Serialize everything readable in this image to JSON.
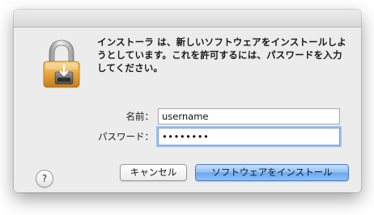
{
  "dialog": {
    "message": "インストーラ は、新しいソフトウェアをインストールしようとしています。これを許可するには、パスワードを入力してください。"
  },
  "form": {
    "name_label": "名前：",
    "name_value": "username",
    "password_label": "パスワード：",
    "password_value": "••••••••"
  },
  "buttons": {
    "help_label": "?",
    "cancel_label": "キャンセル",
    "install_label": "ソフトウェアをインストール"
  },
  "icons": {
    "lock": "padlock-installer-icon",
    "help": "help-icon"
  },
  "colors": {
    "dialog_background": "#ececec",
    "default_button": "#8fbff2",
    "focus_ring": "#9ec3ef",
    "lock_gold": "#e8a63b"
  }
}
